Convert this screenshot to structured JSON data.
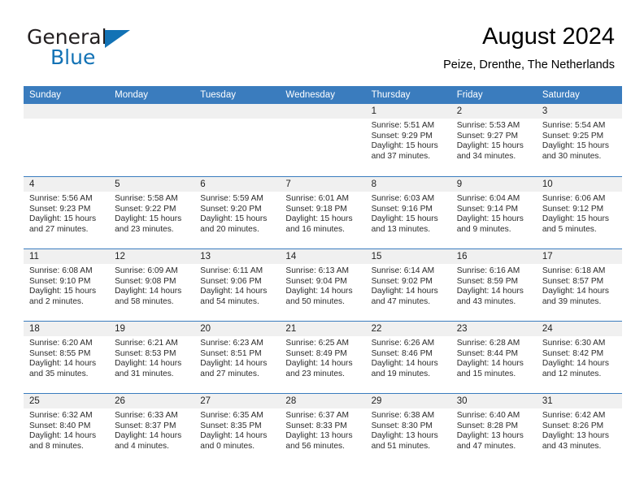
{
  "brand": {
    "name_part1": "General",
    "name_part2": "Blue",
    "accent_color": "#1272b5"
  },
  "header": {
    "title": "August 2024",
    "subtitle": "Peize, Drenthe, The Netherlands"
  },
  "theme": {
    "header_row_color": "#3a7cbe",
    "daynum_band_color": "#f0f0f0",
    "text_color": "#000000"
  },
  "weekday_headers": [
    "Sunday",
    "Monday",
    "Tuesday",
    "Wednesday",
    "Thursday",
    "Friday",
    "Saturday"
  ],
  "weeks": [
    [
      {
        "day": "",
        "lines": []
      },
      {
        "day": "",
        "lines": []
      },
      {
        "day": "",
        "lines": []
      },
      {
        "day": "",
        "lines": []
      },
      {
        "day": "1",
        "lines": [
          "Sunrise: 5:51 AM",
          "Sunset: 9:29 PM",
          "Daylight: 15 hours",
          "and 37 minutes."
        ]
      },
      {
        "day": "2",
        "lines": [
          "Sunrise: 5:53 AM",
          "Sunset: 9:27 PM",
          "Daylight: 15 hours",
          "and 34 minutes."
        ]
      },
      {
        "day": "3",
        "lines": [
          "Sunrise: 5:54 AM",
          "Sunset: 9:25 PM",
          "Daylight: 15 hours",
          "and 30 minutes."
        ]
      }
    ],
    [
      {
        "day": "4",
        "lines": [
          "Sunrise: 5:56 AM",
          "Sunset: 9:23 PM",
          "Daylight: 15 hours",
          "and 27 minutes."
        ]
      },
      {
        "day": "5",
        "lines": [
          "Sunrise: 5:58 AM",
          "Sunset: 9:22 PM",
          "Daylight: 15 hours",
          "and 23 minutes."
        ]
      },
      {
        "day": "6",
        "lines": [
          "Sunrise: 5:59 AM",
          "Sunset: 9:20 PM",
          "Daylight: 15 hours",
          "and 20 minutes."
        ]
      },
      {
        "day": "7",
        "lines": [
          "Sunrise: 6:01 AM",
          "Sunset: 9:18 PM",
          "Daylight: 15 hours",
          "and 16 minutes."
        ]
      },
      {
        "day": "8",
        "lines": [
          "Sunrise: 6:03 AM",
          "Sunset: 9:16 PM",
          "Daylight: 15 hours",
          "and 13 minutes."
        ]
      },
      {
        "day": "9",
        "lines": [
          "Sunrise: 6:04 AM",
          "Sunset: 9:14 PM",
          "Daylight: 15 hours",
          "and 9 minutes."
        ]
      },
      {
        "day": "10",
        "lines": [
          "Sunrise: 6:06 AM",
          "Sunset: 9:12 PM",
          "Daylight: 15 hours",
          "and 5 minutes."
        ]
      }
    ],
    [
      {
        "day": "11",
        "lines": [
          "Sunrise: 6:08 AM",
          "Sunset: 9:10 PM",
          "Daylight: 15 hours",
          "and 2 minutes."
        ]
      },
      {
        "day": "12",
        "lines": [
          "Sunrise: 6:09 AM",
          "Sunset: 9:08 PM",
          "Daylight: 14 hours",
          "and 58 minutes."
        ]
      },
      {
        "day": "13",
        "lines": [
          "Sunrise: 6:11 AM",
          "Sunset: 9:06 PM",
          "Daylight: 14 hours",
          "and 54 minutes."
        ]
      },
      {
        "day": "14",
        "lines": [
          "Sunrise: 6:13 AM",
          "Sunset: 9:04 PM",
          "Daylight: 14 hours",
          "and 50 minutes."
        ]
      },
      {
        "day": "15",
        "lines": [
          "Sunrise: 6:14 AM",
          "Sunset: 9:02 PM",
          "Daylight: 14 hours",
          "and 47 minutes."
        ]
      },
      {
        "day": "16",
        "lines": [
          "Sunrise: 6:16 AM",
          "Sunset: 8:59 PM",
          "Daylight: 14 hours",
          "and 43 minutes."
        ]
      },
      {
        "day": "17",
        "lines": [
          "Sunrise: 6:18 AM",
          "Sunset: 8:57 PM",
          "Daylight: 14 hours",
          "and 39 minutes."
        ]
      }
    ],
    [
      {
        "day": "18",
        "lines": [
          "Sunrise: 6:20 AM",
          "Sunset: 8:55 PM",
          "Daylight: 14 hours",
          "and 35 minutes."
        ]
      },
      {
        "day": "19",
        "lines": [
          "Sunrise: 6:21 AM",
          "Sunset: 8:53 PM",
          "Daylight: 14 hours",
          "and 31 minutes."
        ]
      },
      {
        "day": "20",
        "lines": [
          "Sunrise: 6:23 AM",
          "Sunset: 8:51 PM",
          "Daylight: 14 hours",
          "and 27 minutes."
        ]
      },
      {
        "day": "21",
        "lines": [
          "Sunrise: 6:25 AM",
          "Sunset: 8:49 PM",
          "Daylight: 14 hours",
          "and 23 minutes."
        ]
      },
      {
        "day": "22",
        "lines": [
          "Sunrise: 6:26 AM",
          "Sunset: 8:46 PM",
          "Daylight: 14 hours",
          "and 19 minutes."
        ]
      },
      {
        "day": "23",
        "lines": [
          "Sunrise: 6:28 AM",
          "Sunset: 8:44 PM",
          "Daylight: 14 hours",
          "and 15 minutes."
        ]
      },
      {
        "day": "24",
        "lines": [
          "Sunrise: 6:30 AM",
          "Sunset: 8:42 PM",
          "Daylight: 14 hours",
          "and 12 minutes."
        ]
      }
    ],
    [
      {
        "day": "25",
        "lines": [
          "Sunrise: 6:32 AM",
          "Sunset: 8:40 PM",
          "Daylight: 14 hours",
          "and 8 minutes."
        ]
      },
      {
        "day": "26",
        "lines": [
          "Sunrise: 6:33 AM",
          "Sunset: 8:37 PM",
          "Daylight: 14 hours",
          "and 4 minutes."
        ]
      },
      {
        "day": "27",
        "lines": [
          "Sunrise: 6:35 AM",
          "Sunset: 8:35 PM",
          "Daylight: 14 hours",
          "and 0 minutes."
        ]
      },
      {
        "day": "28",
        "lines": [
          "Sunrise: 6:37 AM",
          "Sunset: 8:33 PM",
          "Daylight: 13 hours",
          "and 56 minutes."
        ]
      },
      {
        "day": "29",
        "lines": [
          "Sunrise: 6:38 AM",
          "Sunset: 8:30 PM",
          "Daylight: 13 hours",
          "and 51 minutes."
        ]
      },
      {
        "day": "30",
        "lines": [
          "Sunrise: 6:40 AM",
          "Sunset: 8:28 PM",
          "Daylight: 13 hours",
          "and 47 minutes."
        ]
      },
      {
        "day": "31",
        "lines": [
          "Sunrise: 6:42 AM",
          "Sunset: 8:26 PM",
          "Daylight: 13 hours",
          "and 43 minutes."
        ]
      }
    ]
  ]
}
